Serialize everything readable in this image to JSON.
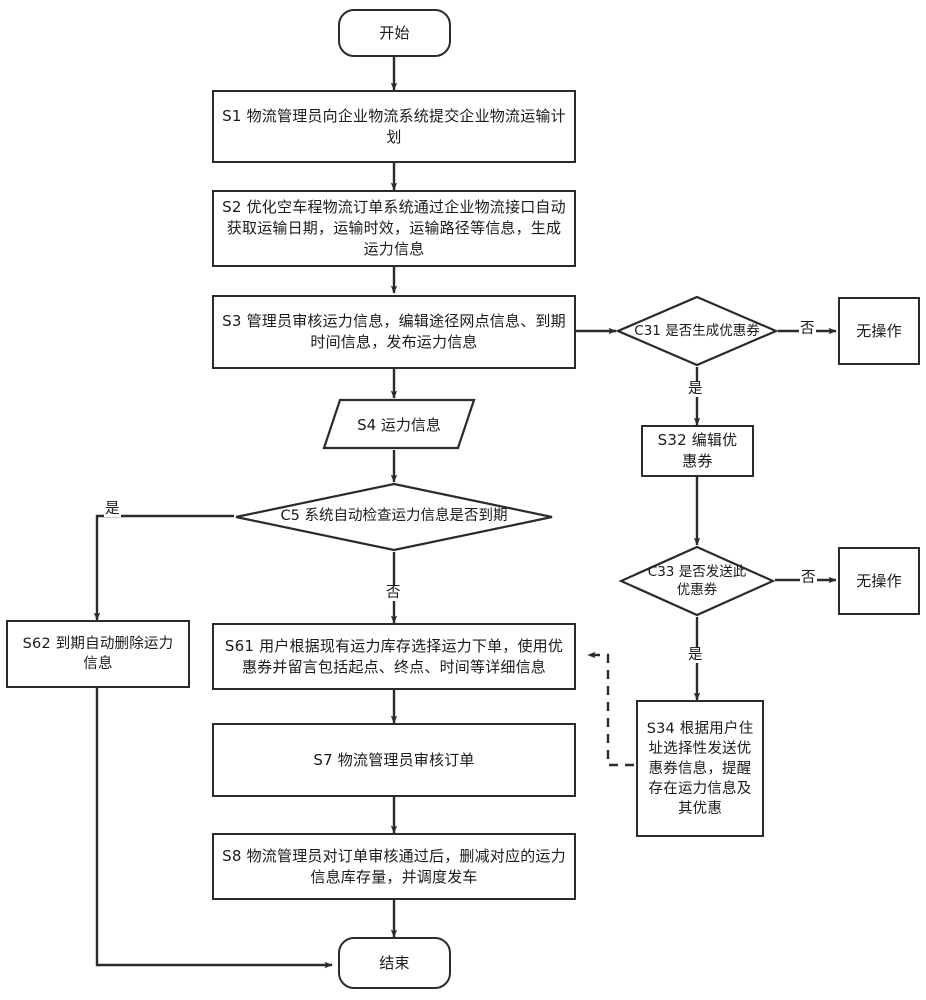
{
  "diagram": {
    "type": "flowchart",
    "language": "zh-CN",
    "colors": {
      "stroke": "#2b2b2b",
      "fill": "#ffffff",
      "text": "#1b1b1b"
    },
    "nodes": {
      "start": {
        "label": "开始",
        "shape": "terminator"
      },
      "s1": {
        "label": "S1 物流管理员向企业物流系统提交企业物流运输计划",
        "shape": "process"
      },
      "s2": {
        "label": "S2 优化空车程物流订单系统通过企业物流接口自动获取运输日期，运输时效，运输路径等信息，生成运力信息",
        "shape": "process"
      },
      "s3": {
        "label": "S3 管理员审核运力信息，编辑途径网点信息、到期时间信息，发布运力信息",
        "shape": "process"
      },
      "c31": {
        "label": "C31 是否生成优惠券",
        "shape": "decision"
      },
      "noop1": {
        "label": "无操作",
        "shape": "process"
      },
      "s32": {
        "label": "S32 编辑优惠券",
        "shape": "process"
      },
      "c33": {
        "label": "C33 是否发送此优惠券",
        "shape": "decision"
      },
      "noop2": {
        "label": "无操作",
        "shape": "process"
      },
      "s34": {
        "label": "S34 根据用户住址选择性发送优惠券信息，提醒存在运力信息及其优惠",
        "shape": "process"
      },
      "s4": {
        "label": "S4 运力信息",
        "shape": "data"
      },
      "c5": {
        "label": "C5 系统自动检查运力信息是否到期",
        "shape": "decision"
      },
      "s62": {
        "label": "S62 到期自动删除运力信息",
        "shape": "process"
      },
      "s61": {
        "label": "S61  用户根据现有运力库存选择运力下单，使用优惠券并留言包括起点、终点、时间等详细信息",
        "shape": "process"
      },
      "s7": {
        "label": "S7 物流管理员审核订单",
        "shape": "process"
      },
      "s8": {
        "label": "S8 物流管理员对订单审核通过后，删减对应的运力信息库存量，并调度发车",
        "shape": "process"
      },
      "end": {
        "label": "结束",
        "shape": "terminator"
      }
    },
    "edge_labels": {
      "c31_no": "否",
      "c31_yes": "是",
      "c33_no": "否",
      "c33_yes": "是",
      "c5_yes": "是",
      "c5_no": "否"
    }
  }
}
